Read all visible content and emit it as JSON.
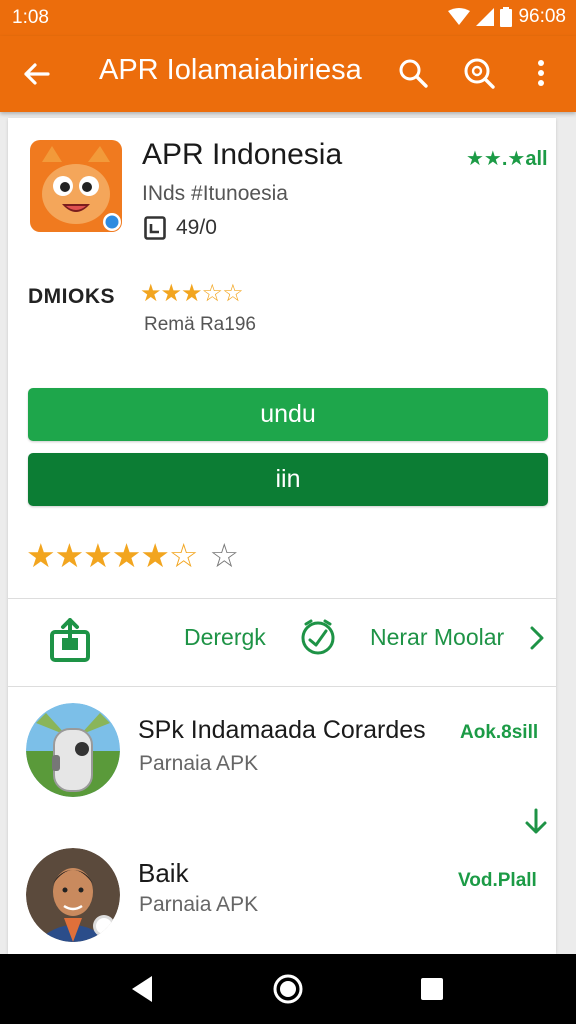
{
  "status": {
    "time": "1:08",
    "clock": "96:08"
  },
  "appbar": {
    "title": "APR Iolamaiabiriesa"
  },
  "app": {
    "name": "APR Indonesia",
    "top_right": "★★.★all",
    "subtitle": "INds #Itunoesia",
    "size": "49/0",
    "downloads_label": "DMIOKS",
    "small_stars": "★★★☆☆",
    "review": "Remä Ra196"
  },
  "buttons": {
    "primary": "undu",
    "secondary": "iin"
  },
  "rating": {
    "stars_filled": "★★★★★☆",
    "star_extra": "☆"
  },
  "actions": {
    "left_label": "Derergk",
    "right_label": "Nerar Moolar"
  },
  "list": [
    {
      "title": "SPk Indamaada Corardes",
      "subtitle": "Parnaia APK",
      "meta": "Aok.8sill"
    },
    {
      "title": "Baik",
      "subtitle": "Parnaia APK",
      "meta": "Vod.Plall"
    }
  ],
  "colors": {
    "accent": "#ec6d0c",
    "green": "#1ea64b",
    "dark_green": "#0c7d34",
    "star": "#f2a51f"
  }
}
